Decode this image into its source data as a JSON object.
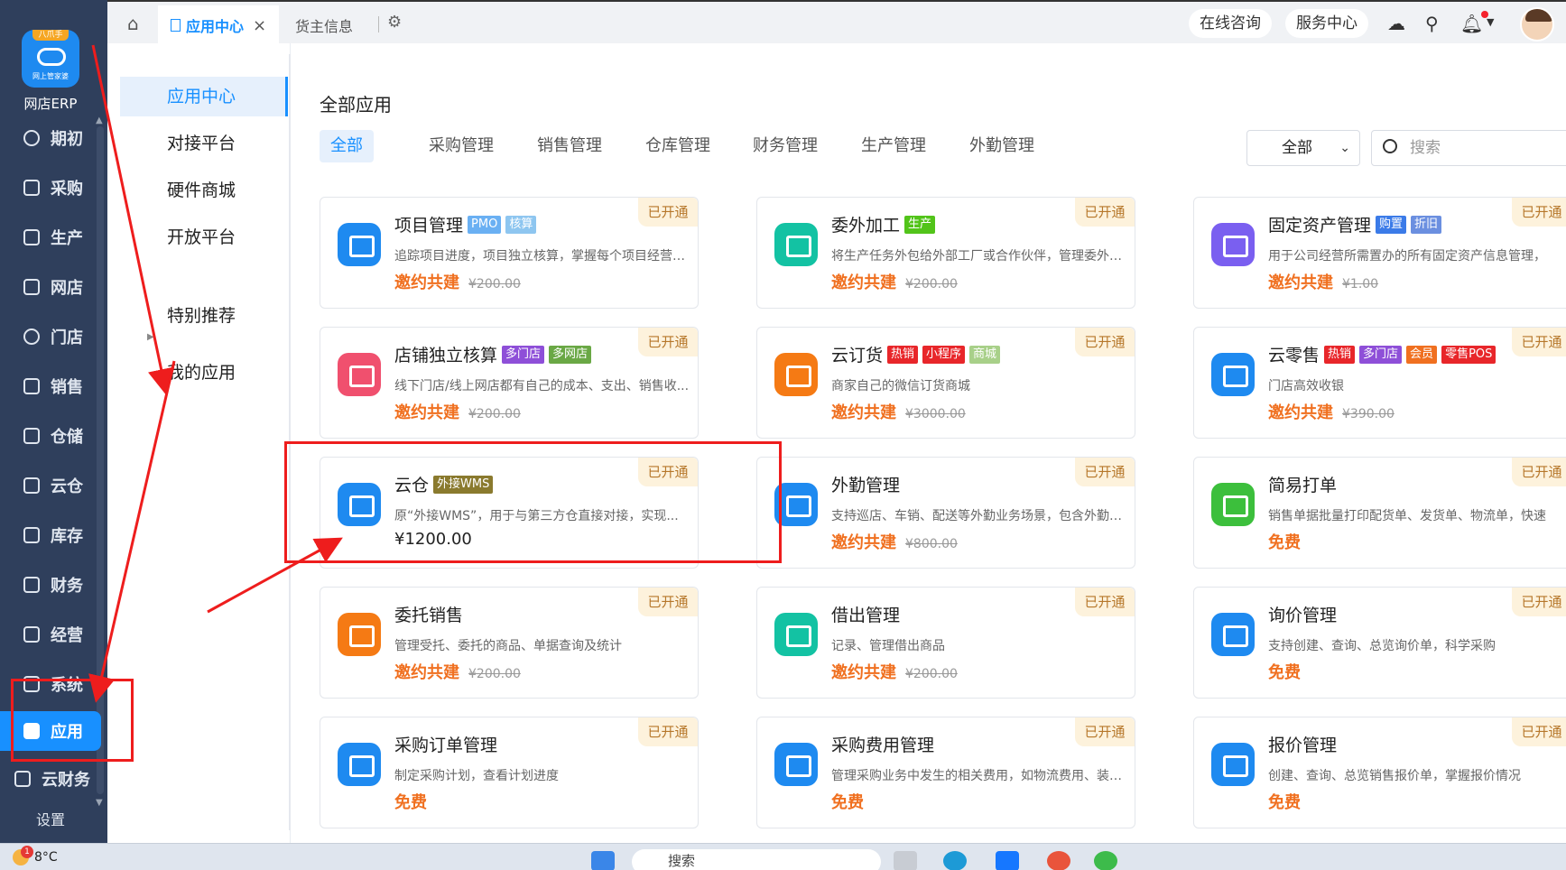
{
  "sidebar": {
    "logo_badge": "八爪手",
    "logo_sub": "网上管家婆",
    "logo_name": "网店ERP",
    "items": [
      {
        "label": "期初",
        "icon": "circle-icon"
      },
      {
        "label": "采购",
        "icon": "purchase-icon"
      },
      {
        "label": "生产",
        "icon": "production-icon"
      },
      {
        "label": "网店",
        "icon": "store-icon"
      },
      {
        "label": "门店",
        "icon": "pie-icon"
      },
      {
        "label": "销售",
        "icon": "chart-icon"
      },
      {
        "label": "仓储",
        "icon": "warehouse-icon"
      },
      {
        "label": "云仓",
        "icon": "cloud-warehouse-icon"
      },
      {
        "label": "库存",
        "icon": "inventory-icon"
      },
      {
        "label": "财务",
        "icon": "finance-icon"
      },
      {
        "label": "经营",
        "icon": "operation-icon"
      },
      {
        "label": "系统",
        "icon": "system-icon"
      },
      {
        "label": "应用",
        "icon": "app-icon"
      },
      {
        "label": "云财务",
        "icon": "cloud-finance-icon"
      }
    ],
    "settings": "设置"
  },
  "topbar": {
    "tabs": [
      {
        "label": "应用中心"
      },
      {
        "label": "货主信息"
      }
    ],
    "consult": "在线咨询",
    "service": "服务中心"
  },
  "subnav": {
    "items": [
      "应用中心",
      "对接平台",
      "硬件商城",
      "开放平台",
      "特别推荐",
      "我的应用"
    ]
  },
  "main": {
    "title": "全部应用",
    "categories": [
      "全部",
      "采购管理",
      "销售管理",
      "仓库管理",
      "财务管理",
      "生产管理",
      "外勤管理"
    ],
    "filter_value": "全部",
    "search_placeholder": "搜索",
    "cards": [
      {
        "name": "项目管理",
        "tags": [
          {
            "t": "PMO",
            "c": "#6ab0f3"
          },
          {
            "t": "核算",
            "c": "#8ec6f0"
          }
        ],
        "desc": "追踪项目进度，项目独立核算，掌握每个项目经营情况",
        "price": "邀约共建",
        "old": "¥200.00",
        "badge": "已开通",
        "color": "#1e8af0"
      },
      {
        "name": "委外加工",
        "tags": [
          {
            "t": "生产",
            "c": "#52c41a"
          }
        ],
        "desc": "将生产任务外包给外部工厂或合作伙伴，管理委外商...",
        "price": "邀约共建",
        "old": "¥200.00",
        "badge": "已开通",
        "color": "#13c2a3"
      },
      {
        "name": "固定资产管理",
        "tags": [
          {
            "t": "购置",
            "c": "#3b7be8"
          },
          {
            "t": "折旧",
            "c": "#6b8fe0"
          }
        ],
        "desc": "用于公司经营所需置办的所有固定资产信息管理，",
        "price": "邀约共建",
        "old": "¥1.00",
        "badge": "已开通",
        "color": "#7a5ff0"
      },
      {
        "name": "店铺独立核算",
        "tags": [
          {
            "t": "多门店",
            "c": "#8e4fd8"
          },
          {
            "t": "多网店",
            "c": "#6aa845"
          }
        ],
        "desc": "线下门店/线上网店都有自己的成本、支出、销售收...",
        "price": "邀约共建",
        "old": "¥200.00",
        "badge": "已开通",
        "color": "#f0506e"
      },
      {
        "name": "云订货",
        "tags": [
          {
            "t": "热销",
            "c": "#e8262a"
          },
          {
            "t": "小程序",
            "c": "#e8262a"
          },
          {
            "t": "商城",
            "c": "#a8d089"
          }
        ],
        "desc": "商家自己的微信订货商城",
        "price": "邀约共建",
        "old": "¥3000.00",
        "badge": "已开通",
        "color": "#f57a14"
      },
      {
        "name": "云零售",
        "tags": [
          {
            "t": "热销",
            "c": "#e8262a"
          },
          {
            "t": "多门店",
            "c": "#8e4fd8"
          },
          {
            "t": "会员",
            "c": "#f07020"
          },
          {
            "t": "零售POS",
            "c": "#e8262a"
          }
        ],
        "desc": "门店高效收银",
        "price": "邀约共建",
        "old": "¥390.00",
        "badge": "已开通",
        "color": "#1e8af0"
      },
      {
        "name": "云仓",
        "tags": [
          {
            "t": "外接WMS",
            "c": "#8a7a2e"
          }
        ],
        "desc": "原“外接WMS”，用于与第三方仓直接对接，实现...",
        "price": "¥1200.00",
        "old": "",
        "badge": "已开通",
        "color": "#1e8af0",
        "dark": true
      },
      {
        "name": "外勤管理",
        "tags": [],
        "desc": "支持巡店、车销、配送等外勤业务场景，包含外勤计...",
        "price": "邀约共建",
        "old": "¥800.00",
        "badge": "已开通",
        "color": "#1e8af0"
      },
      {
        "name": "简易打单",
        "tags": [],
        "desc": "销售单据批量打印配货单、发货单、物流单，快速",
        "price": "免费",
        "old": "",
        "badge": "已开通",
        "color": "#3cbf3c"
      },
      {
        "name": "委托销售",
        "tags": [],
        "desc": "管理受托、委托的商品、单据查询及统计",
        "price": "邀约共建",
        "old": "¥200.00",
        "badge": "已开通",
        "color": "#f57a14"
      },
      {
        "name": "借出管理",
        "tags": [],
        "desc": "记录、管理借出商品",
        "price": "邀约共建",
        "old": "¥200.00",
        "badge": "已开通",
        "color": "#13c2a3"
      },
      {
        "name": "询价管理",
        "tags": [],
        "desc": "支持创建、查询、总览询价单，科学采购",
        "price": "免费",
        "old": "",
        "badge": "已开通",
        "color": "#1e8af0"
      },
      {
        "name": "采购订单管理",
        "tags": [],
        "desc": "制定采购计划，查看计划进度",
        "price": "免费",
        "old": "",
        "badge": "已开通",
        "color": "#1e8af0"
      },
      {
        "name": "采购费用管理",
        "tags": [],
        "desc": "管理采购业务中发生的相关费用，如物流费用、装卸费",
        "price": "免费",
        "old": "",
        "badge": "已开通",
        "color": "#1e8af0"
      },
      {
        "name": "报价管理",
        "tags": [],
        "desc": "创建、查询、总览销售报价单，掌握报价情况",
        "price": "免费",
        "old": "",
        "badge": "已开通",
        "color": "#1e8af0"
      }
    ]
  },
  "taskbar": {
    "weather": "8°C",
    "weather_badge": "1",
    "search": "搜索"
  }
}
